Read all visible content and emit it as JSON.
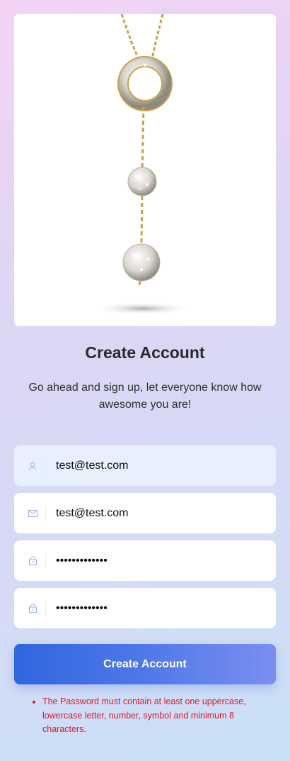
{
  "header": {
    "title": "Create Account",
    "subtitle": "Go ahead and sign up, let everyone know how awesome you are!"
  },
  "form": {
    "fields": [
      {
        "icon": "user-icon",
        "type": "text",
        "value": "test@test.com"
      },
      {
        "icon": "mail-icon",
        "type": "text",
        "value": "test@test.com"
      },
      {
        "icon": "lock-icon",
        "type": "password",
        "value": "•••••••••••••"
      },
      {
        "icon": "lock-icon",
        "type": "password",
        "value": "•••••••••••••"
      }
    ],
    "submit_label": "Create Account"
  },
  "errors": [
    "The Password must contain at least one uppercase, lowercase letter, number, symbol and minimum 8 characters."
  ],
  "colors": {
    "accent": "#3a6ee4",
    "error": "#e0162b",
    "active_field": "#e8f0fd"
  }
}
